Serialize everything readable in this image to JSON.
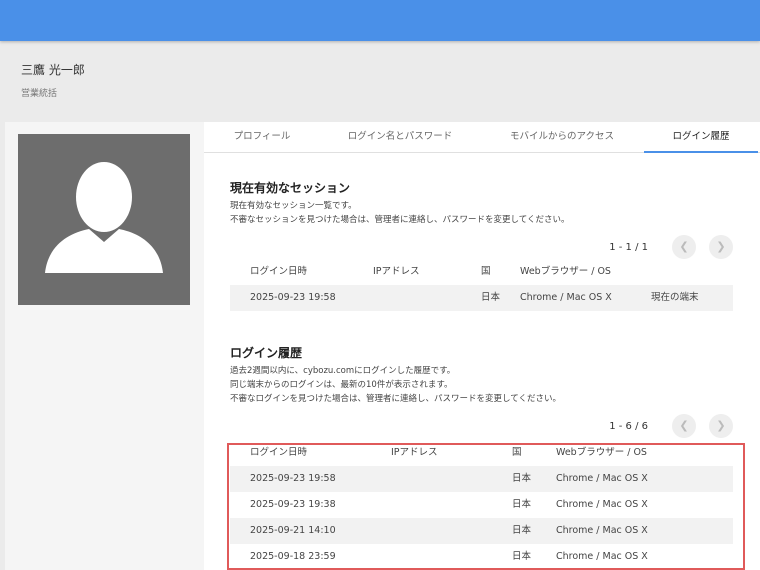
{
  "user": {
    "name": "三鷹 光一郎",
    "title": "営業統括"
  },
  "tabs": [
    {
      "label": "プロフィール",
      "active": false
    },
    {
      "label": "ログイン名とパスワード",
      "active": false
    },
    {
      "label": "モバイルからのアクセス",
      "active": false
    },
    {
      "label": "ログイン履歴",
      "active": true
    }
  ],
  "sessions": {
    "title": "現在有効なセッション",
    "desc_line1": "現在有効なセッション一覧です。",
    "desc_line2": "不審なセッションを見つけた場合は、管理者に連絡し、パスワードを変更してください。",
    "pager": "1 - 1 / 1",
    "headers": {
      "date": "ログイン日時",
      "ip": "IPアドレス",
      "country": "国",
      "browser": "Webブラウザー / OS"
    },
    "rows": [
      {
        "date": "2025-09-23 19:58",
        "ip": "",
        "country": "日本",
        "browser": "Chrome / Mac OS X",
        "note": "現在の端末"
      }
    ]
  },
  "history": {
    "title": "ログイン履歴",
    "desc_line1": "過去2週間以内に、cybozu.comにログインした履歴です。",
    "desc_line2": "同じ端末からのログインは、最新の10件が表示されます。",
    "desc_line3": "不審なログインを見つけた場合は、管理者に連絡し、パスワードを変更してください。",
    "pager": "1 - 6 / 6",
    "headers": {
      "date": "ログイン日時",
      "ip": "IPアドレス",
      "country": "国",
      "browser": "Webブラウザー / OS"
    },
    "rows": [
      {
        "date": "2025-09-23 19:58",
        "ip": "",
        "country": "日本",
        "browser": "Chrome / Mac OS X"
      },
      {
        "date": "2025-09-23 19:38",
        "ip": "",
        "country": "日本",
        "browser": "Chrome / Mac OS X"
      },
      {
        "date": "2025-09-21 14:10",
        "ip": "",
        "country": "日本",
        "browser": "Chrome / Mac OS X"
      },
      {
        "date": "2025-09-18 23:59",
        "ip": "",
        "country": "日本",
        "browser": "Chrome / Mac OS X"
      }
    ]
  },
  "icons": {
    "prev": "chevron-left-icon",
    "next": "chevron-right-icon",
    "avatar": "user-silhouette-icon"
  },
  "colors": {
    "topbar": "#4a90e8",
    "active_tab": "#4a90e8",
    "highlight": "#e05a5a"
  }
}
